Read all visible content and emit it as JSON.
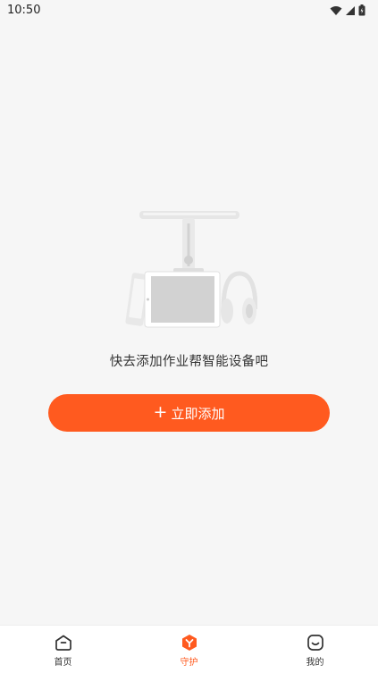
{
  "status_bar": {
    "time": "10:50",
    "icons": [
      "wifi-icon",
      "signal-icon",
      "battery-icon"
    ]
  },
  "empty_state": {
    "illustration": "devices-illustration",
    "message": "快去添加作业帮智能设备吧"
  },
  "add_button": {
    "icon": "plus-icon",
    "label": "立即添加"
  },
  "bottom_nav": {
    "items": [
      {
        "label": "首页",
        "icon": "home-icon",
        "active": false
      },
      {
        "label": "守护",
        "icon": "guard-icon",
        "active": true
      },
      {
        "label": "我的",
        "icon": "profile-icon",
        "active": false
      }
    ]
  },
  "colors": {
    "accent": "#ff5a1f",
    "background": "#f6f6f6",
    "text": "#333333"
  }
}
